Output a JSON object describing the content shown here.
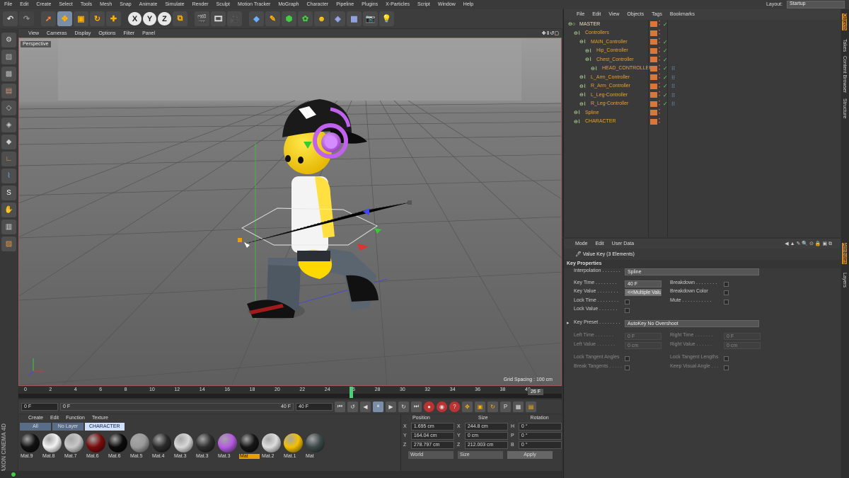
{
  "menubar": {
    "items": [
      "File",
      "Edit",
      "Create",
      "Select",
      "Tools",
      "Mesh",
      "Snap",
      "Animate",
      "Simulate",
      "Render",
      "Sculpt",
      "Motion Tracker",
      "MoGraph",
      "Character",
      "Pipeline",
      "Plugins",
      "X-Particles",
      "Script",
      "Window",
      "Help"
    ],
    "layout_label": "Layout:",
    "layout_value": "Startup"
  },
  "toolbar": {
    "x": "X",
    "y": "Y",
    "z": "Z"
  },
  "viewport": {
    "menu": [
      "View",
      "Cameras",
      "Display",
      "Options",
      "Filter",
      "Panel"
    ],
    "label": "Perspective",
    "grid_spacing": "Grid Spacing : 100 cm"
  },
  "timeline": {
    "ticks": [
      "0",
      "2",
      "4",
      "6",
      "8",
      "10",
      "12",
      "14",
      "16",
      "18",
      "20",
      "22",
      "24",
      "26",
      "28",
      "30",
      "32",
      "34",
      "36",
      "38",
      "40"
    ],
    "current_frame": "26 F",
    "playhead_frame": 26
  },
  "transport": {
    "start": "0 F",
    "range_start": "0 F",
    "range_end": "40 F",
    "end": "40 F"
  },
  "materials": {
    "menu": [
      "Create",
      "Edit",
      "Function",
      "Texture"
    ],
    "filters": [
      "All",
      "No Layer",
      "CHARACTER"
    ],
    "items": [
      {
        "label": "Mat.9",
        "color": "#111"
      },
      {
        "label": "Mat.8",
        "color": "#f2f2f2"
      },
      {
        "label": "Mat.7",
        "color": "#c8c8c8"
      },
      {
        "label": "Mat.6",
        "color": "#7a0c0c"
      },
      {
        "label": "Mat.6",
        "color": "#0b0b0b"
      },
      {
        "label": "Mat.5",
        "color": "#9a9a9a"
      },
      {
        "label": "Mat.4",
        "color": "#2a2a2a"
      },
      {
        "label": "Mat.3",
        "color": "#d8d8d8"
      },
      {
        "label": "Mat.3",
        "color": "#2d2d2d"
      },
      {
        "label": "Mat.3",
        "color": "#b45be0"
      },
      {
        "label": "Mat",
        "color": "#151515"
      },
      {
        "label": "Mat.2",
        "color": "#ddd"
      },
      {
        "label": "Mat.1",
        "color": "#f4c000"
      },
      {
        "label": "Mat",
        "color": "#3d4848"
      }
    ]
  },
  "coords": {
    "headers": [
      "Position",
      "Size",
      "Rotation"
    ],
    "rows": [
      {
        "axis": "X",
        "pos": "1.695 cm",
        "size": "244.8 cm",
        "rlabel": "H",
        "rot": "0 °"
      },
      {
        "axis": "Y",
        "pos": "164.04 cm",
        "size": "0 cm",
        "rlabel": "P",
        "rot": "0 °"
      },
      {
        "axis": "Z",
        "pos": "278.797 cm",
        "size": "212.003 cm",
        "rlabel": "B",
        "rot": "0 °"
      }
    ],
    "mode1": "World",
    "mode2": "Size",
    "apply": "Apply"
  },
  "objects": {
    "menu": [
      "File",
      "Edit",
      "View",
      "Objects",
      "Tags",
      "Bookmarks"
    ],
    "rows": [
      {
        "name": "MASTER",
        "indent": 0
      },
      {
        "name": "Controllers",
        "indent": 1
      },
      {
        "name": "MAIN_Controller",
        "indent": 2
      },
      {
        "name": "Hip_Controller",
        "indent": 3
      },
      {
        "name": "Chest_Controller",
        "indent": 3
      },
      {
        "name": "HEAD_CONTROLLER",
        "indent": 4
      },
      {
        "name": "L_Arm_Controller",
        "indent": 2
      },
      {
        "name": "R_Arm_Controller",
        "indent": 2
      },
      {
        "name": "L_Leg-Controller",
        "indent": 2
      },
      {
        "name": "R_Leg-Controller",
        "indent": 2
      },
      {
        "name": "Spline",
        "indent": 1
      },
      {
        "name": "CHARACTER",
        "indent": 1
      }
    ]
  },
  "attributes": {
    "menu": [
      "Mode",
      "Edit",
      "User Data"
    ],
    "title": "Value Key (3 Elements)",
    "section": "Key Properties",
    "interpolation_label": "Interpolation . . . . . . .",
    "interpolation": "Spline",
    "key_time_label": "Key Time . . . . . . . .",
    "key_time": "40 F",
    "key_value_label": "Key Value . . . . . . . .",
    "key_value": "<<Multiple Values>>",
    "lock_time_label": "Lock Time . . . . . . . .",
    "lock_value_label": "Lock Value . . . . . . .",
    "breakdown_label": "Breakdown . . . . . . . .",
    "breakdown_color_label": "Breakdown Color",
    "mute_label": "Mute . . . . . . . . . . .",
    "key_preset_label": "Key Preset . . . . . . . .",
    "key_preset": "AutoKey No Overshoot",
    "left_time_label": "Left Time . . . . . . .",
    "left_time": "0 F",
    "right_time_label": "Right Time . . . . . . .",
    "right_time": "0 F",
    "left_value_label": "Left Value . . . . . . .",
    "left_value": "0 cm",
    "right_value_label": "Right Value . . . . . .",
    "right_value": "0 cm",
    "lock_tangent_angles": "Lock Tangent Angles",
    "lock_tangent_lengths": "Lock Tangent Lengths",
    "break_tangents": "Break Tangents . . . . .",
    "keep_visual_angle": "Keep Visual Angle . . ."
  },
  "side_tabs": {
    "top": [
      "Objects",
      "Takes",
      "Content Browser",
      "Structure"
    ],
    "bottom": [
      "Attributes",
      "Layers"
    ]
  },
  "brand": "MAXON CINEMA 4D"
}
